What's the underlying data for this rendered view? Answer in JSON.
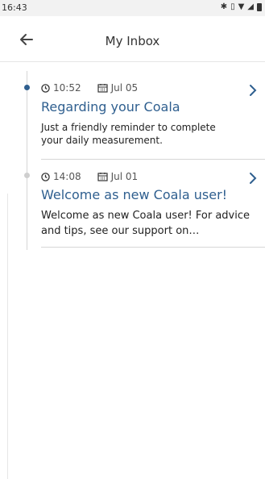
{
  "status": {
    "time": "16:43"
  },
  "appbar": {
    "title": "My Inbox"
  },
  "messages": [
    {
      "time": "10:52",
      "date": "Jul 05",
      "subject": "Regarding your Coala",
      "preview": "Just a friendly reminder to complete your daily measurement.",
      "unread": true
    },
    {
      "time": "14:08",
      "date": "Jul 01",
      "subject": "Welcome as new Coala user!",
      "preview": "Welcome as new Coala user!  For advice and tips, see our support on…",
      "unread": false
    }
  ],
  "colors": {
    "accent": "#2f5f8f",
    "unread_dot": "#2f5f8f",
    "read_dot": "#cfcfcf"
  },
  "icons": {
    "back": "arrow-left-icon",
    "clock": "clock-icon",
    "calendar": "calendar-icon",
    "chevron": "chevron-right-icon"
  }
}
